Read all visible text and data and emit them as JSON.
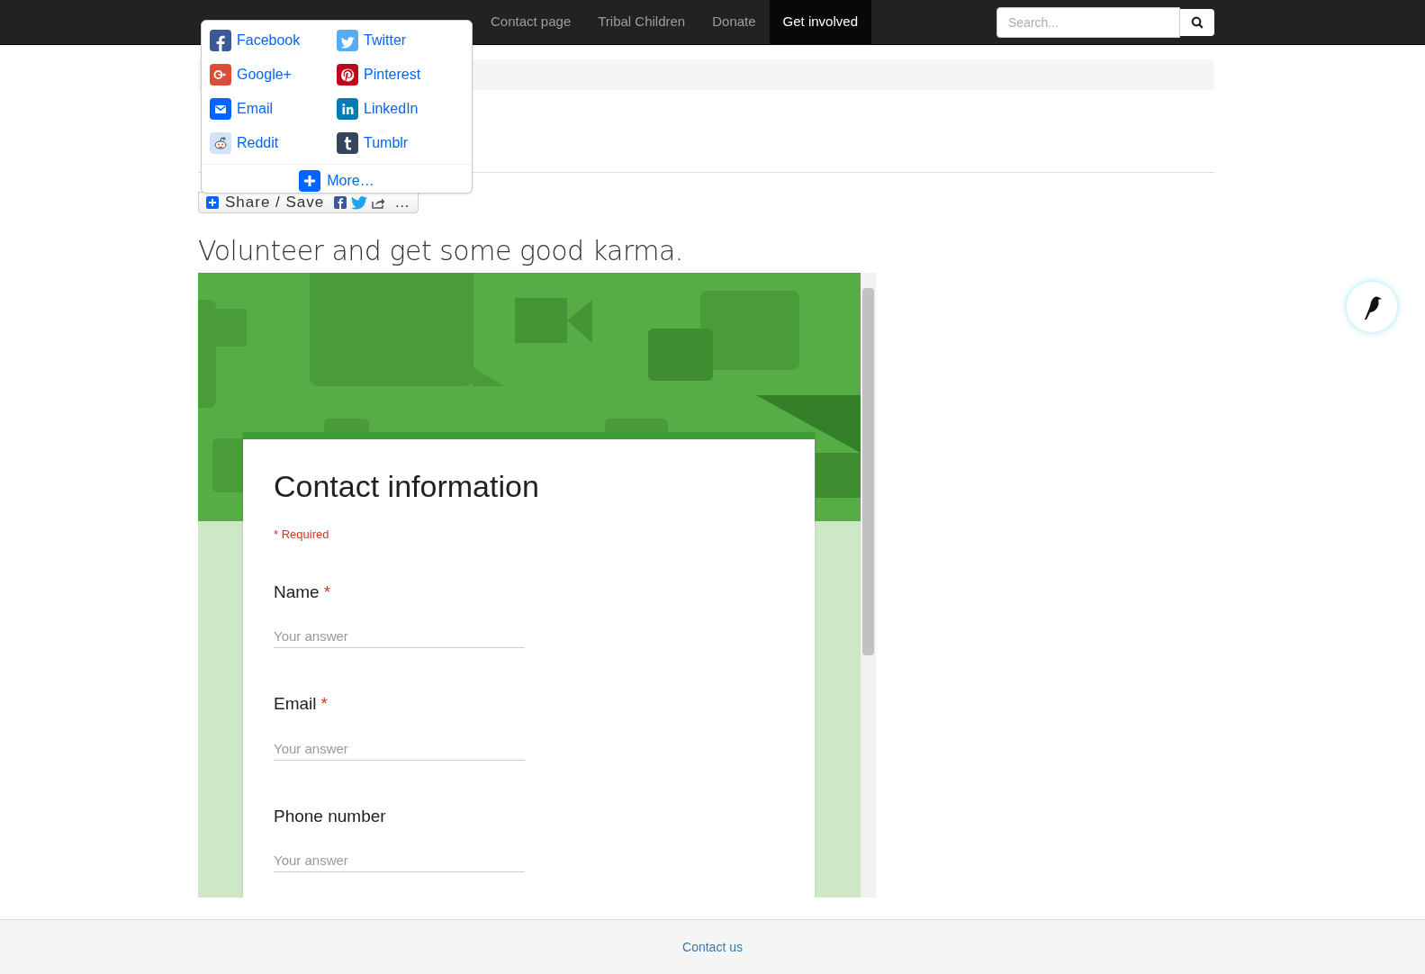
{
  "nav": {
    "items": [
      {
        "label": "Contact page",
        "selected": false
      },
      {
        "label": "Tribal Children",
        "selected": false
      },
      {
        "label": "Donate",
        "selected": false
      },
      {
        "label": "Get involved",
        "selected": true
      }
    ],
    "search": {
      "placeholder": "Search..."
    }
  },
  "share_menu": {
    "items": [
      {
        "kind": "facebook",
        "label": "Facebook"
      },
      {
        "kind": "twitter",
        "label": "Twitter"
      },
      {
        "kind": "google",
        "label": "Google+"
      },
      {
        "kind": "pinterest",
        "label": "Pinterest"
      },
      {
        "kind": "email",
        "label": "Email"
      },
      {
        "kind": "linkedin",
        "label": "LinkedIn"
      },
      {
        "kind": "reddit",
        "label": "Reddit"
      },
      {
        "kind": "tumblr",
        "label": "Tumblr"
      }
    ],
    "more": "More…"
  },
  "share_button": {
    "label": "Share / Save",
    "ellipsis": "…"
  },
  "heading": "Volunteer and get some good karma.",
  "form": {
    "title": "Contact information",
    "required_note": "* Required",
    "questions": [
      {
        "label": "Name",
        "required_mark": "*",
        "placeholder": "Your answer"
      },
      {
        "label": "Email",
        "required_mark": "*",
        "placeholder": "Your answer"
      },
      {
        "label": "Phone number",
        "placeholder": "Your answer"
      }
    ]
  },
  "footer": {
    "link": "Contact us"
  }
}
